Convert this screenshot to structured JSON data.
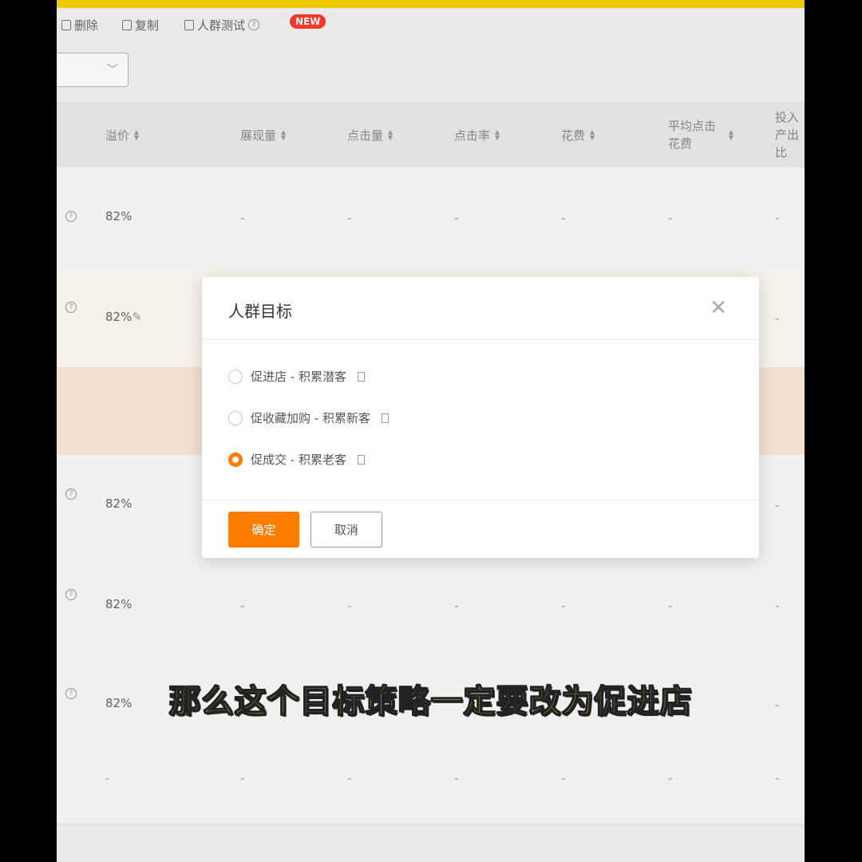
{
  "toolbar": {
    "delete_label": "删除",
    "copy_label": "复制",
    "crowd_test_label": "人群测试",
    "new_badge": "NEW"
  },
  "table": {
    "headers": [
      "溢价",
      "展现量",
      "点击量",
      "点击率",
      "花费",
      "平均点击花费",
      "投入产出比"
    ],
    "rows": [
      {
        "premium": "82%",
        "cells": [
          "-",
          "-",
          "-",
          "-",
          "-",
          "-"
        ]
      },
      {
        "premium": "82%",
        "cells": [
          "-"
        ]
      },
      {
        "premium": "82%",
        "cells": [
          "-"
        ]
      },
      {
        "premium": "82%",
        "cells": [
          "-",
          "-",
          "-",
          "-",
          "-",
          "-"
        ]
      },
      {
        "premium": "82%",
        "cells": [
          "-"
        ]
      },
      {
        "premium": "-",
        "cells": [
          "-",
          "-",
          "-",
          "-",
          "-",
          "-"
        ]
      }
    ]
  },
  "modal": {
    "title": "人群目标",
    "options": [
      {
        "label": "促进店 - 积累潜客",
        "selected": false
      },
      {
        "label": "促收藏加购 - 积累新客",
        "selected": false
      },
      {
        "label": "促成交 - 积累老客",
        "selected": true
      }
    ],
    "confirm_label": "确定",
    "cancel_label": "取消"
  },
  "subtitle": "那么这个目标策略一定要改为促进店",
  "colors": {
    "accent": "#ff7d00",
    "top_bar": "#f6d200",
    "subtitle": "#f7e03b",
    "badge": "#ff3b30"
  }
}
